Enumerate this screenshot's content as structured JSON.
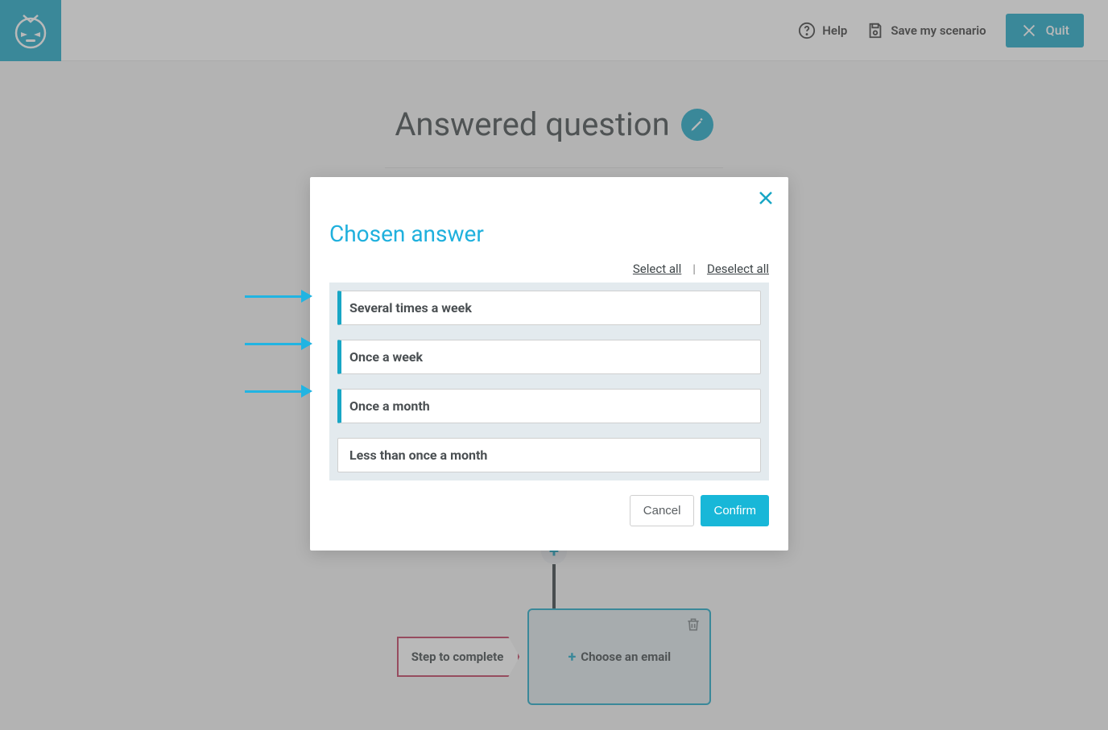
{
  "header": {
    "help_label": "Help",
    "save_label": "Save my scenario",
    "quit_label": "Quit"
  },
  "page": {
    "title": "Answered question"
  },
  "flow": {
    "step_tag_label": "Step to complete",
    "choose_email_label": "Choose an email"
  },
  "modal": {
    "title": "Chosen answer",
    "select_all_label": "Select all",
    "deselect_all_label": "Deselect all",
    "options": [
      {
        "label": "Several times a week",
        "selected": true
      },
      {
        "label": "Once a week",
        "selected": true
      },
      {
        "label": "Once a month",
        "selected": true
      },
      {
        "label": "Less than once a month",
        "selected": false
      }
    ],
    "cancel_label": "Cancel",
    "confirm_label": "Confirm"
  },
  "colors": {
    "brand": "#18a6c5"
  }
}
